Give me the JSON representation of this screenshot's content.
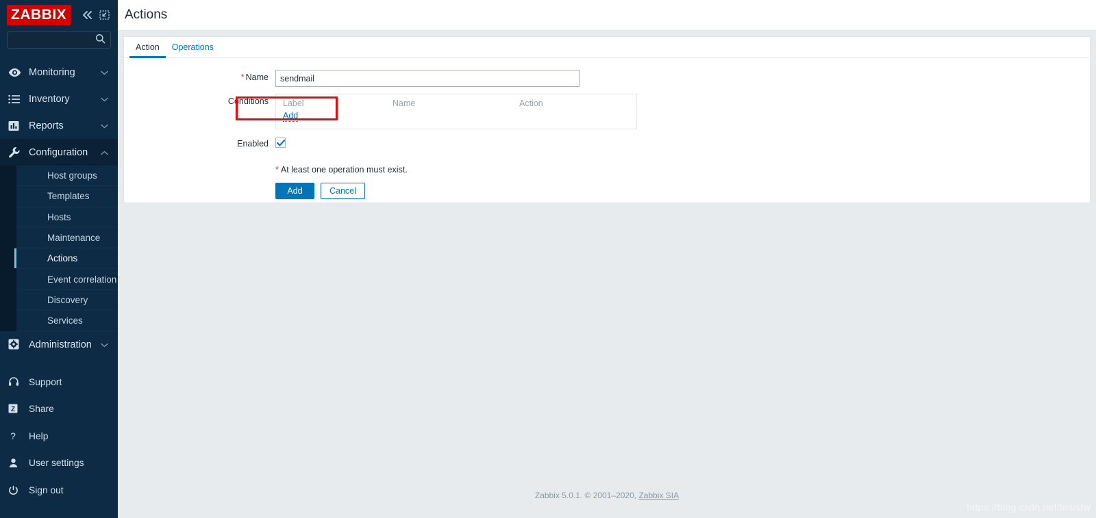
{
  "sidebar": {
    "logo_text": "ZABBIX",
    "collapse_icon": "double-chevron-left-icon",
    "hide_icon": "collapse-pane-icon",
    "search": {
      "value": "",
      "placeholder": ""
    },
    "nav": [
      {
        "label": "Monitoring",
        "icon": "eye-icon",
        "chevron": "chevron-down",
        "expanded": false
      },
      {
        "label": "Inventory",
        "icon": "list-icon",
        "chevron": "chevron-down",
        "expanded": false
      },
      {
        "label": "Reports",
        "icon": "bar-chart-icon",
        "chevron": "chevron-down",
        "expanded": false
      },
      {
        "label": "Configuration",
        "icon": "wrench-icon",
        "chevron": "chevron-up",
        "expanded": true
      }
    ],
    "submenu": [
      {
        "label": "Host groups",
        "active": false
      },
      {
        "label": "Templates",
        "active": false
      },
      {
        "label": "Hosts",
        "active": false
      },
      {
        "label": "Maintenance",
        "active": false
      },
      {
        "label": "Actions",
        "active": true
      },
      {
        "label": "Event correlation",
        "active": false
      },
      {
        "label": "Discovery",
        "active": false
      },
      {
        "label": "Services",
        "active": false
      }
    ],
    "nav_admin": {
      "label": "Administration",
      "icon": "gear-icon",
      "chevron": "chevron-down"
    },
    "nav_bottom": [
      {
        "label": "Support",
        "icon": "headset-icon"
      },
      {
        "label": "Share",
        "icon": "zabbix-share-icon"
      },
      {
        "label": "Help",
        "icon": "question-mark-icon"
      },
      {
        "label": "User settings",
        "icon": "user-icon"
      },
      {
        "label": "Sign out",
        "icon": "power-icon"
      }
    ]
  },
  "header": {
    "title": "Actions"
  },
  "tabs": [
    {
      "label": "Action",
      "active": true
    },
    {
      "label": "Operations",
      "active": false
    }
  ],
  "form": {
    "name_label": "Name",
    "name_required_marker": "*",
    "name_value": "sendmail",
    "name_placeholder": "",
    "conditions_label": "Conditions",
    "conditions_columns": [
      "Label",
      "Name",
      "Action"
    ],
    "conditions_rows": [],
    "conditions_add_link": "Add",
    "enabled_label": "Enabled",
    "enabled_checked": true,
    "operation_note_star": "*",
    "operation_note": "At least one operation must exist.",
    "submit_label": "Add",
    "cancel_label": "Cancel"
  },
  "footer": {
    "text": "Zabbix 5.0.1. © 2001–2020, ",
    "link": "Zabbix SIA"
  },
  "watermark": "https://blog.csdn.net/Insistw",
  "colors": {
    "brand_red": "#d40000",
    "sidebar_bg": "#0e2b45",
    "accent_blue": "#0275b8",
    "active_bar": "#76c3e8",
    "required_red": "#d23f31",
    "annotation_red": "#ff0000",
    "page_bg": "#e8ebee"
  }
}
